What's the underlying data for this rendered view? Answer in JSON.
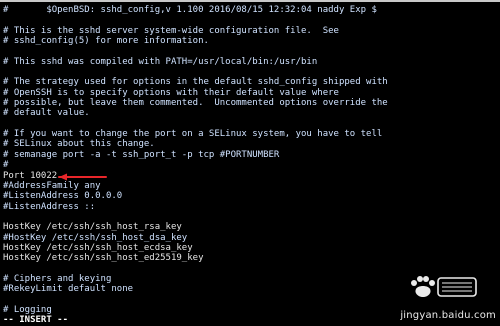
{
  "terminal": {
    "lines": [
      "#       $OpenBSD: sshd_config,v 1.100 2016/08/15 12:32:04 naddy Exp $",
      "",
      "# This is the sshd server system-wide configuration file.  See",
      "# sshd_config(5) for more information.",
      "",
      "# This sshd was compiled with PATH=/usr/local/bin:/usr/bin",
      "",
      "# The strategy used for options in the default sshd_config shipped with",
      "# OpenSSH is to specify options with their default value where",
      "# possible, but leave them commented.  Uncommented options override the",
      "# default value.",
      "",
      "# If you want to change the port on a SELinux system, you have to tell",
      "# SELinux about this change.",
      "# semanage port -a -t ssh_port_t -p tcp #PORTNUMBER",
      "#",
      "Port 10022",
      "#AddressFamily any",
      "#ListenAddress 0.0.0.0",
      "#ListenAddress ::",
      "",
      "HostKey /etc/ssh/ssh_host_rsa_key",
      "#HostKey /etc/ssh/ssh_host_dsa_key",
      "HostKey /etc/ssh/ssh_host_ecdsa_key",
      "HostKey /etc/ssh/ssh_host_ed25519_key",
      "",
      "# Ciphers and keying",
      "#RekeyLimit default none",
      "",
      "# Logging",
      "-- INSERT --"
    ]
  },
  "watermark": {
    "site": "jingyan.baidu.com",
    "logo_text": "百度经验"
  },
  "colors": {
    "background": "#000000",
    "text": "#e6e6e6",
    "arrow": "#e8262a"
  }
}
